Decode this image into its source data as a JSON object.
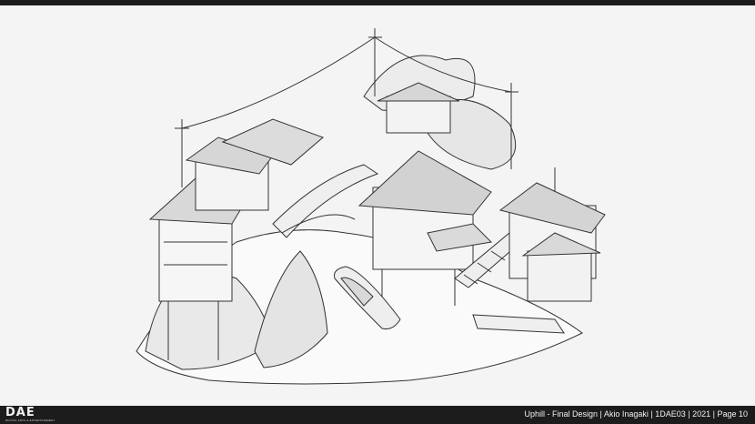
{
  "logo": {
    "mark": "DAE",
    "subtitle": "DIGITAL ARTS & ENTERTAINMENT"
  },
  "caption": "Uphill - Final Design | Akio Inagaki | 1DAE03 | 2021 | Page 10"
}
